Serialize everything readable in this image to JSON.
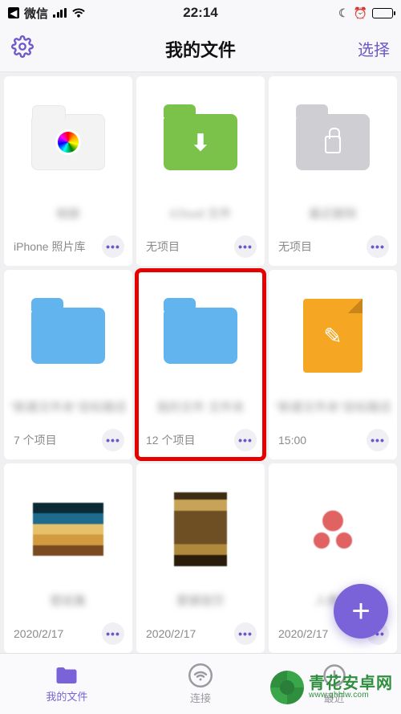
{
  "status_bar": {
    "back_app": "微信",
    "time": "22:14"
  },
  "nav": {
    "title": "我的文件",
    "select": "选择"
  },
  "tiles": [
    {
      "label": "相册",
      "meta": "iPhone 照片库",
      "label_blur": true
    },
    {
      "label": "iCloud 文件",
      "meta": "无项目",
      "label_blur": true
    },
    {
      "label": "最近删除",
      "meta": "无项目",
      "label_blur": true
    },
    {
      "label": "\"新建文件夹\"目标路径",
      "meta": "7 个项目",
      "label_blur": true
    },
    {
      "label": "我的文件 文件夹",
      "meta": "12 个项目",
      "label_blur": true
    },
    {
      "label": "\"新建文件夹\"目标路径",
      "meta": "15:00",
      "label_blur": true
    },
    {
      "label": "壁纸集",
      "meta": "2020/2/17",
      "label_blur": true
    },
    {
      "label": "蒙娜丽莎",
      "meta": "2020/2/17",
      "label_blur": true
    },
    {
      "label": "人像图",
      "meta": "2020/2/17",
      "label_blur": true
    }
  ],
  "tabs": {
    "files": "我的文件",
    "connect": "连接",
    "recent": "最近"
  },
  "watermark": {
    "name": "青花安卓网",
    "url": "www.qhhlw.com"
  },
  "colors": {
    "accent": "#7a63d8",
    "highlight": "#e60000",
    "brand": "#2f8f3e"
  }
}
